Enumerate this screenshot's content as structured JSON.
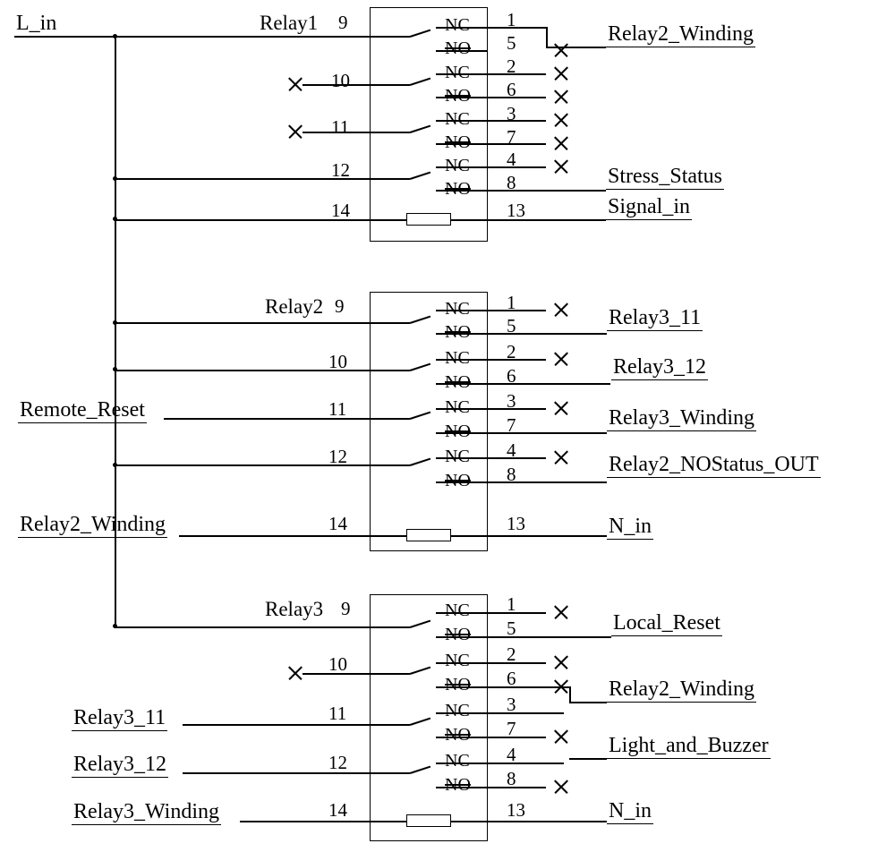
{
  "inputs": {
    "l_in": "L_in",
    "remote_reset": "Remote_Reset",
    "relay2_winding_in": "Relay2_Winding",
    "relay3_11_in": "Relay3_11",
    "relay3_12_in": "Relay3_12",
    "relay3_winding_in": "Relay3_Winding"
  },
  "outputs": {
    "relay2_winding": "Relay2_Winding",
    "stress_status": "Stress_Status",
    "signal_in": "Signal_in",
    "relay3_11": "Relay3_11",
    "relay3_12": "Relay3_12",
    "relay3_winding": "Relay3_Winding",
    "relay2_nostatus_out": "Relay2_NOStatus_OUT",
    "n_in_1": "N_in",
    "local_reset": "Local_Reset",
    "relay2_winding_2": "Relay2_Winding",
    "light_and_buzzer": "Light_and_Buzzer",
    "n_in_2": "N_in"
  },
  "contact": {
    "nc": "NC",
    "no": "NO"
  },
  "pins": {
    "p1": "1",
    "p2": "2",
    "p3": "3",
    "p4": "4",
    "p5": "5",
    "p6": "6",
    "p7": "7",
    "p8": "8",
    "p9": "9",
    "p10": "10",
    "p11": "11",
    "p12": "12",
    "p13": "13",
    "p14": "14"
  },
  "relays": {
    "r1": "Relay1",
    "r2": "Relay2",
    "r3": "Relay3"
  }
}
